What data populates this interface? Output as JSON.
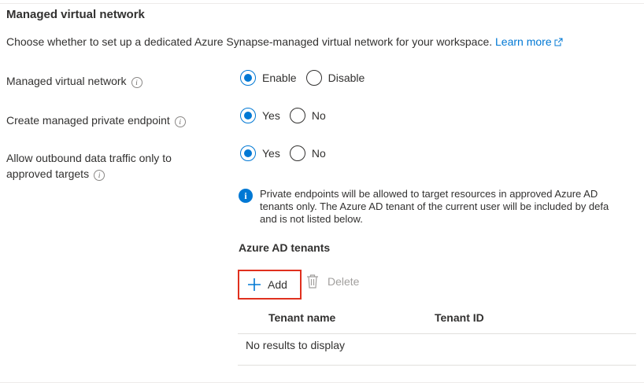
{
  "section": {
    "title": "Managed virtual network",
    "description": "Choose whether to set up a dedicated Azure Synapse-managed virtual network for your workspace.",
    "learn_more": "Learn more"
  },
  "fields": {
    "managed_vnet": {
      "label": "Managed virtual network",
      "options": [
        "Enable",
        "Disable"
      ],
      "selected": "Enable"
    },
    "private_endpoint": {
      "label": "Create managed private endpoint",
      "options": [
        "Yes",
        "No"
      ],
      "selected": "Yes"
    },
    "outbound": {
      "label_line1": "Allow outbound data traffic only to",
      "label_line2": "approved targets",
      "options": [
        "Yes",
        "No"
      ],
      "selected": "Yes"
    }
  },
  "info_message": "Private endpoints will be allowed to target resources in approved Azure AD\ntenants only. The Azure AD tenant of the current user will be included by defa\nand is not listed below.",
  "tenants": {
    "heading": "Azure AD tenants",
    "add_label": "Add",
    "delete_label": "Delete",
    "columns": [
      "Tenant name",
      "Tenant ID"
    ],
    "empty_text": "No results to display"
  },
  "colors": {
    "accent": "#0078d4",
    "highlight_border": "#e0301e",
    "disabled_text": "#a19f9d"
  },
  "icons": {
    "info": "info-icon",
    "external_link": "external-link-icon",
    "info_filled": "info-filled-icon",
    "add": "plus-icon",
    "delete": "trash-icon"
  }
}
